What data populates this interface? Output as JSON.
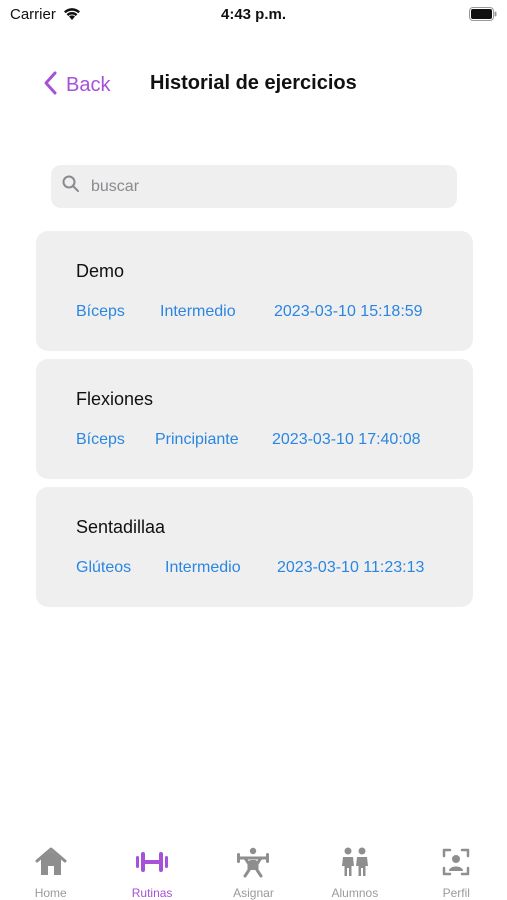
{
  "status_bar": {
    "carrier": "Carrier",
    "time": "4:43 p.m."
  },
  "nav": {
    "back_label": "Back",
    "title": "Historial de ejercicios"
  },
  "search": {
    "placeholder": "buscar"
  },
  "exercises": [
    {
      "name": "Demo",
      "muscle": "Bíceps",
      "level": "Intermedio",
      "datetime": "2023-03-10 15:18:59"
    },
    {
      "name": "Flexiones",
      "muscle": "Bíceps",
      "level": "Principiante",
      "datetime": "2023-03-10 17:40:08"
    },
    {
      "name": "Sentadillaa",
      "muscle": "Glúteos",
      "level": "Intermedio",
      "datetime": "2023-03-10 11:23:13"
    }
  ],
  "tabs": [
    {
      "label": "Home",
      "icon": "house-icon",
      "active": false
    },
    {
      "label": "Rutinas",
      "icon": "dumbbell-icon",
      "active": true
    },
    {
      "label": "Asignar",
      "icon": "weightlifter-icon",
      "active": false
    },
    {
      "label": "Alumnos",
      "icon": "two-people-icon",
      "active": false
    },
    {
      "label": "Perfil",
      "icon": "person-viewfinder-icon",
      "active": false
    }
  ],
  "colors": {
    "accent": "#a651d8",
    "link": "#2b86e0",
    "inactive": "#9a9a9a",
    "card_bg": "#efeff0"
  }
}
